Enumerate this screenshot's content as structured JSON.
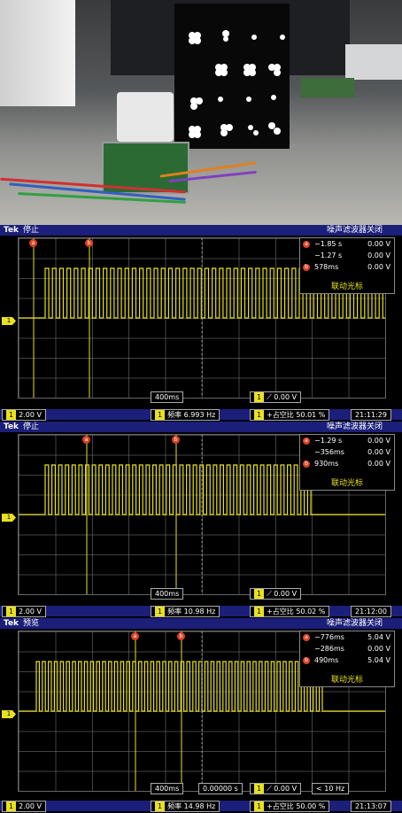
{
  "photo": {
    "description_icons": [
      "led-panel-icon",
      "circuit-board-icon",
      "cable-bundle-icon"
    ]
  },
  "scopes": [
    {
      "brand": "Tek",
      "state": "停止",
      "noise_filter": "噪声滤波器关闭",
      "cursor_a": {
        "time": "−1.85 s",
        "volt": "0.00 V"
      },
      "cursor_b": {
        "time": "−1.27 s",
        "volt": "0.00 V"
      },
      "delta": {
        "time": "578ms",
        "volt": "0.00 V"
      },
      "cursor_mode": "联动光标",
      "ch_marker": "1",
      "timebase": "400ms",
      "trigger_level": "0.00 V",
      "ch_scale": "2.00 V",
      "freq_label": "频率",
      "freq_value": "6.993 Hz",
      "duty_label": "+占空比",
      "duty_value": "50.01 %",
      "clock": "21:11:29"
    },
    {
      "brand": "Tek",
      "state": "停止",
      "noise_filter": "噪声滤波器关闭",
      "cursor_a": {
        "time": "−1.29 s",
        "volt": "0.00 V"
      },
      "cursor_b": {
        "time": "−356ms",
        "volt": "0.00 V"
      },
      "delta": {
        "time": "930ms",
        "volt": "0.00 V"
      },
      "cursor_mode": "联动光标",
      "ch_marker": "1",
      "timebase": "400ms",
      "trigger_level": "0.00 V",
      "ch_scale": "2.00 V",
      "freq_label": "频率",
      "freq_value": "10.98 Hz",
      "duty_label": "+占空比",
      "duty_value": "50.02 %",
      "clock": "21:12:00"
    },
    {
      "brand": "Tek",
      "state": "预览",
      "noise_filter": "噪声滤波器关闭",
      "cursor_a": {
        "time": "−776ms",
        "volt": "5.04 V"
      },
      "cursor_b": {
        "time": "−286ms",
        "volt": "0.00 V"
      },
      "delta": {
        "time": "490ms",
        "volt": "5.04 V"
      },
      "cursor_mode": "联动光标",
      "ch_marker": "1",
      "timebase": "400ms",
      "trigger_pos": "0.00000 s",
      "trigger_level": "0.00 V",
      "trigger_freq": "< 10 Hz",
      "ch_scale": "2.00 V",
      "freq_label": "频率",
      "freq_value": "14.98 Hz",
      "duty_label": "+占空比",
      "duty_value": "50.00 %",
      "clock": "21:13:07"
    }
  ],
  "colors": {
    "trace": "#e8e020",
    "bar": "#1b1f7a",
    "cursor_icon": "#e04020"
  }
}
